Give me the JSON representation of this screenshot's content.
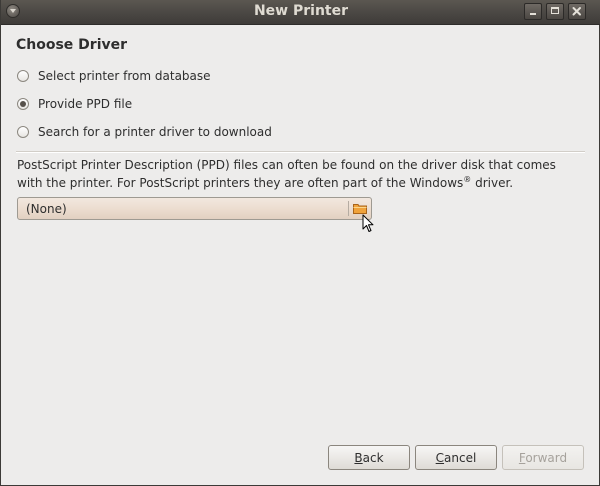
{
  "window": {
    "title": "New Printer"
  },
  "heading": "Choose Driver",
  "options": [
    {
      "label": "Select printer from database",
      "checked": false
    },
    {
      "label": "Provide PPD file",
      "checked": true
    },
    {
      "label": "Search for a printer driver to download",
      "checked": false
    }
  ],
  "description": {
    "line1": "PostScript Printer Description (PPD) files can often be found on the driver disk that comes",
    "line2_before": "with the printer. For PostScript printers they are often part of the Windows",
    "registered_mark": "®",
    "line2_after": " driver."
  },
  "file_chooser": {
    "value": "(None)",
    "icon": "folder-icon"
  },
  "buttons": {
    "back_mnemonic": "B",
    "back_rest": "ack",
    "cancel_mnemonic": "C",
    "cancel_rest": "ancel",
    "forward_mnemonic": "F",
    "forward_rest": "orward",
    "forward_enabled": false
  },
  "titlebar_buttons": [
    "minimize-icon",
    "maximize-icon",
    "close-icon"
  ]
}
